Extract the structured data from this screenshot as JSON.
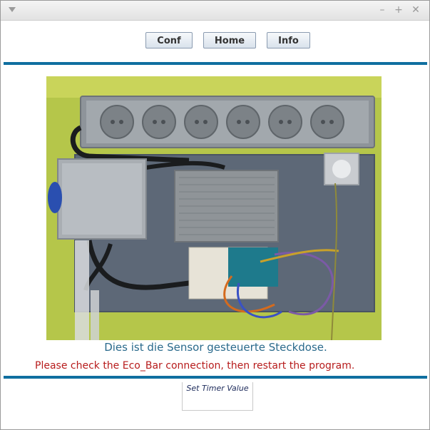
{
  "titlebar": {
    "menu_icon": "chevron-down-icon",
    "minimize_glyph": "–",
    "maximize_glyph": "+",
    "close_glyph": "✕"
  },
  "nav": {
    "conf_label": "Conf",
    "home_label": "Home",
    "info_label": "Info"
  },
  "main": {
    "image_alt": "Sensor controlled power strip photo",
    "caption": "Dies ist die Sensor gesteuerte Steckdose.",
    "error_message": "Please check the Eco_Bar connection, then restart the program."
  },
  "timer": {
    "label": "Set Timer Value"
  },
  "colors": {
    "accent": "#0f6fa0",
    "error": "#b71c1c",
    "caption": "#2a6a8c"
  }
}
